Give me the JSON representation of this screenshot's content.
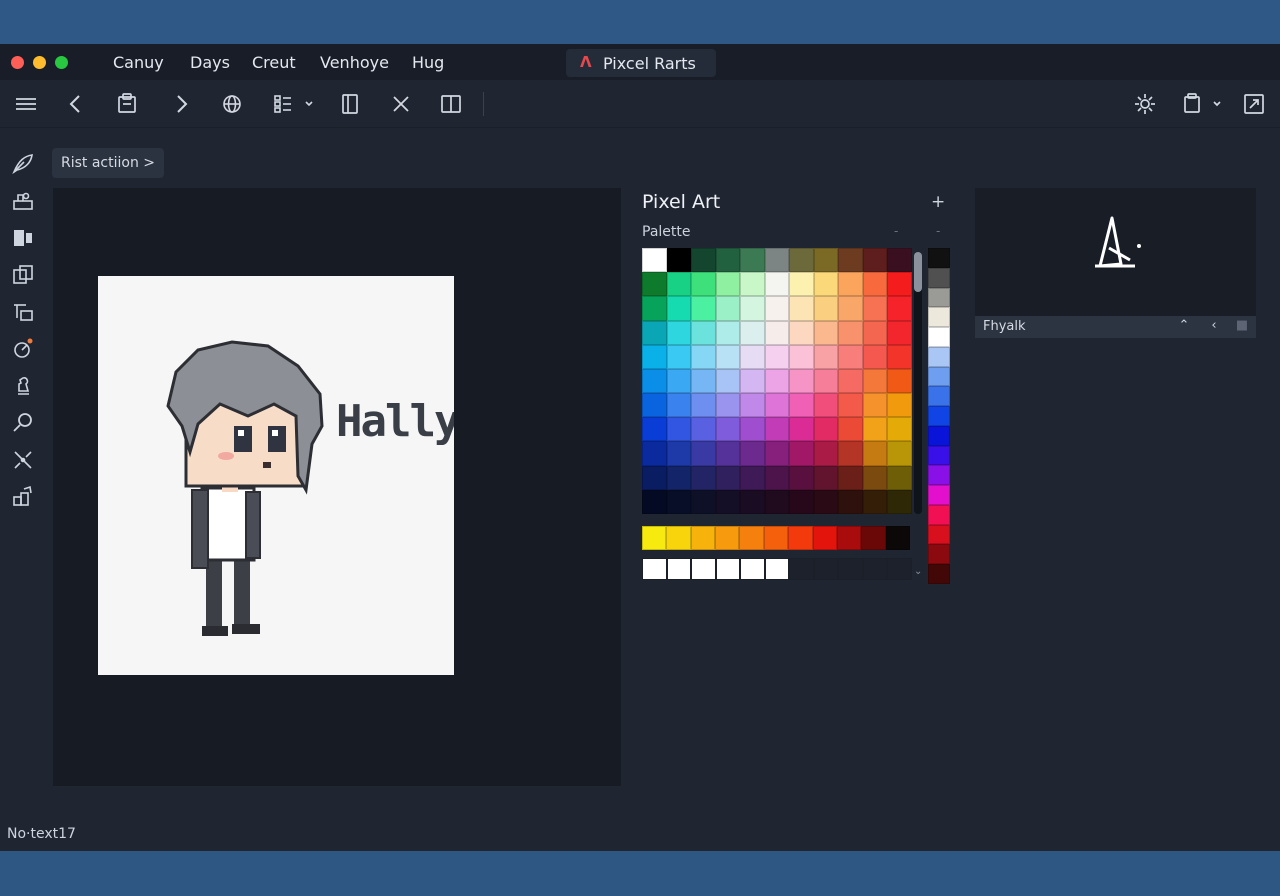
{
  "menubar": {
    "items": [
      "Canuy",
      "Days",
      "Creut",
      "Venhoye",
      "Hug"
    ]
  },
  "window": {
    "title": "Pixcel Rarts"
  },
  "toolbar": {
    "left_icons": [
      "menu-icon",
      "back-icon",
      "clipboard-icon",
      "forward-icon",
      "globe-icon",
      "list-dropdown-icon",
      "panel-icon",
      "close-icon",
      "split-view-icon"
    ],
    "right_icons": [
      "gear-icon",
      "clipboard-dropdown-icon",
      "export-icon"
    ]
  },
  "sidebar": {
    "icons": [
      "feather-icon",
      "cart-icon",
      "media-icon",
      "layers-icon",
      "text-icon",
      "paint-icon",
      "chess-icon",
      "search-icon",
      "sparkle-icon",
      "stack-icon"
    ]
  },
  "action_button": {
    "label": "Rist actiion >"
  },
  "canvas": {
    "art_text": "Hally"
  },
  "panel": {
    "title": "Pixel Art",
    "add_label": "+",
    "palette_label": "Palette",
    "palette_grid": [
      [
        "#ffffff",
        "#000000",
        "#14452f",
        "#22613f",
        "#3b7a53",
        "#7d8584",
        "#6c6a3a",
        "#7a6a26",
        "#6d3b1f",
        "#5e1e1e",
        "#3a1020"
      ],
      [
        "#0e7a2c",
        "#18d184",
        "#3de07a",
        "#8ef0a0",
        "#c9f7c7",
        "#f4f4f0",
        "#fdf1b0",
        "#fbd97a",
        "#fba45c",
        "#f86a3d",
        "#f41c1c"
      ],
      [
        "#08a35a",
        "#17dbb0",
        "#4bf0a0",
        "#9bf0c8",
        "#d4f6e0",
        "#f7f1ee",
        "#fde4b4",
        "#fbcf80",
        "#f9a768",
        "#f77252",
        "#f6232a"
      ],
      [
        "#0aa6b6",
        "#2ed6e0",
        "#6be2dc",
        "#aeecea",
        "#dbefef",
        "#f6ece9",
        "#fdd8c0",
        "#fbb88e",
        "#f8926c",
        "#f56650",
        "#f3262e"
      ],
      [
        "#0ab0e8",
        "#39c9f2",
        "#86d7f5",
        "#b8e1f6",
        "#e6dcf4",
        "#f5d0ef",
        "#fbc1d6",
        "#f9a2a6",
        "#f77e7a",
        "#f4584e",
        "#f2342a"
      ],
      [
        "#0a8ee8",
        "#3aa8f2",
        "#76b6f5",
        "#a8c4f6",
        "#d4b6f2",
        "#eda4e6",
        "#f794c6",
        "#f67e98",
        "#f56a62",
        "#f4783a",
        "#f05a16"
      ],
      [
        "#0a64e0",
        "#3a82ee",
        "#6e8ef0",
        "#9a94ee",
        "#c088e8",
        "#df74d8",
        "#f060b4",
        "#f24e7c",
        "#f35a4a",
        "#f6922c",
        "#f29a0e"
      ],
      [
        "#0a3cd6",
        "#3256e2",
        "#5a60e2",
        "#7e5cdc",
        "#a04ed0",
        "#c23cb8",
        "#da2c94",
        "#e22a64",
        "#ea4a36",
        "#f2a218",
        "#e4aa08"
      ],
      [
        "#0a2a9e",
        "#1e3aa8",
        "#3a3aa4",
        "#54329a",
        "#6c2a8e",
        "#86207c",
        "#a01866",
        "#aa1c46",
        "#b43426",
        "#c67a12",
        "#b89608"
      ],
      [
        "#0a1c62",
        "#142468",
        "#222466",
        "#30205e",
        "#3e1a56",
        "#4c144a",
        "#5a103e",
        "#62142e",
        "#6a2018",
        "#7a4a0e",
        "#6e5e08"
      ],
      [
        "#040a24",
        "#080e28",
        "#0e1028",
        "#140e26",
        "#1a0c22",
        "#200a1e",
        "#26081a",
        "#2a0a14",
        "#2e100c",
        "#341e08",
        "#2e2806"
      ]
    ],
    "side_strip": [
      "#111111",
      "#505050",
      "#9a9a96",
      "#ece8dc",
      "#ffffff",
      "#aac6f4",
      "#6e9ef0",
      "#3a72ea",
      "#1044e4",
      "#0a14d8",
      "#3a10e8",
      "#8a10e8",
      "#e210cc",
      "#f21054",
      "#d8101e",
      "#8a0a10",
      "#420808"
    ],
    "warm_row": [
      "#f6ea0e",
      "#f8d40c",
      "#f8b20c",
      "#f89a0e",
      "#f6800e",
      "#f4600c",
      "#f23a0c",
      "#e2140c",
      "#a80c0c",
      "#6a0808",
      "#0c0808"
    ],
    "custom_row": [
      "#ffffff",
      "#ffffff",
      "#ffffff",
      "#ffffff",
      "#ffffff",
      "#ffffff",
      "#1c212b",
      "#1c212b",
      "#1c212b",
      "#1c212b",
      "#1c212b"
    ]
  },
  "preview": {
    "label": "Fhyalk"
  },
  "status": {
    "text": "No·text17"
  },
  "colors": {
    "window_bg": "#1f2531",
    "desktop": "#2e5480",
    "accent_red": "#e5484d"
  }
}
